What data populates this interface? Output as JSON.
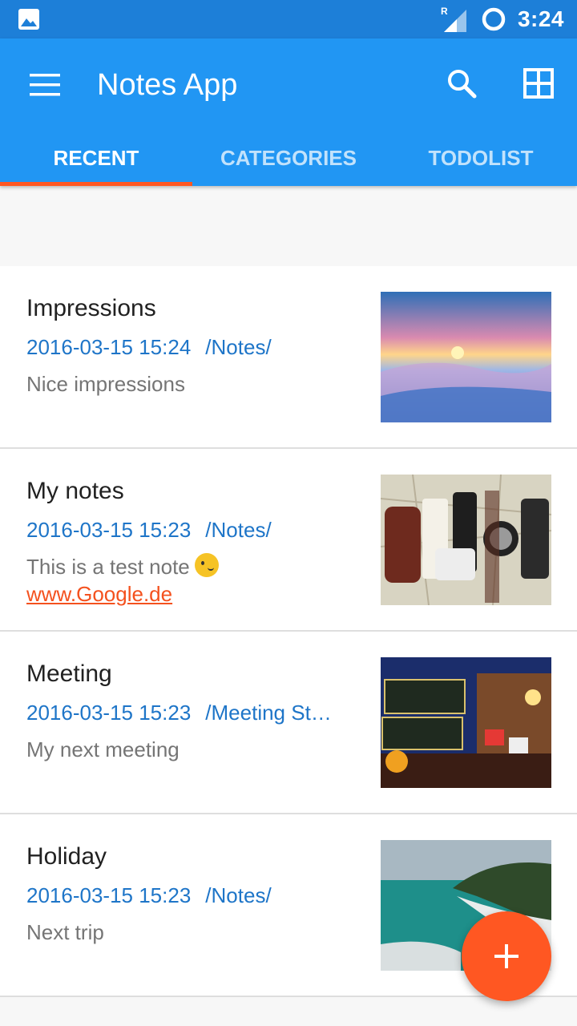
{
  "status_bar": {
    "time": "3:24",
    "network_label": "R",
    "icons": [
      "image-icon",
      "signal-icon",
      "sync-icon"
    ]
  },
  "app_bar": {
    "title": "Notes App",
    "menu_icon": "menu-icon",
    "search_icon": "search-icon",
    "grid_icon": "grid-view-icon",
    "color": "#2196f3"
  },
  "tabs": [
    {
      "label": "RECENT",
      "active": true
    },
    {
      "label": "CATEGORIES",
      "active": false
    },
    {
      "label": "TODOLIST",
      "active": false
    }
  ],
  "notes": [
    {
      "title": "Impressions",
      "date": "2016-03-15 15:24",
      "category": "/Notes/",
      "body": "Nice impressions",
      "image": "sunset-over-snow"
    },
    {
      "title": "My notes",
      "date": "2016-03-15 15:23",
      "category": "/Notes/",
      "body": "This is a test note",
      "link": "www.Google.de",
      "image": "gadgets-on-map"
    },
    {
      "title": "Meeting",
      "date": "2016-03-15 15:23",
      "category": "/Meeting St…",
      "body": "My next meeting",
      "image": "street-signs-night"
    },
    {
      "title": "Holiday",
      "date": "2016-03-15 15:23",
      "category": "/Notes/",
      "body": "Next trip",
      "image": "coastal-lake"
    }
  ],
  "fab": {
    "icon": "add-icon",
    "color": "#ff5722"
  }
}
